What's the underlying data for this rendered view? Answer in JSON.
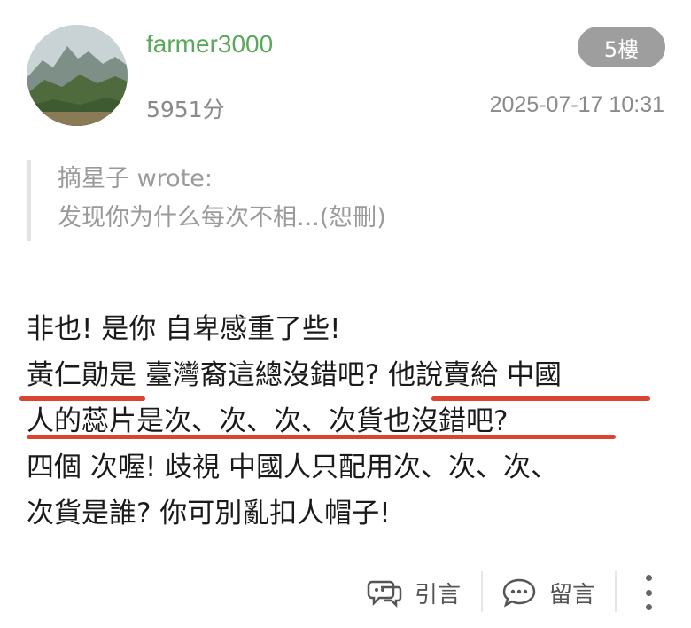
{
  "post": {
    "username": "farmer3000",
    "score": "5951分",
    "floor": "5樓",
    "timestamp": "2025-07-17 10:31",
    "avatar": "landscape-photo"
  },
  "quote": {
    "author": "摘星子 wrote:",
    "text": "发现你为什么每次不相...(恕刪)"
  },
  "content": {
    "lines": [
      "非也! 是你 自卑感重了些!",
      "黃仁勛是 臺灣裔這總沒錯吧? 他說賣給 中國",
      "人的蕊片是次、次、次、次貨也沒錯吧?",
      "四個 次喔! 歧視 中國人只配用次、次、次、",
      "次貨是誰? 你可別亂扣人帽子!"
    ],
    "highlight_color": "#d9452f"
  },
  "actions": {
    "quote_label": "引言",
    "reply_label": "留言",
    "quote_icon": "quote-bubble-icon",
    "reply_icon": "comment-bubble-icon",
    "more_icon": "more-vertical-icon"
  }
}
